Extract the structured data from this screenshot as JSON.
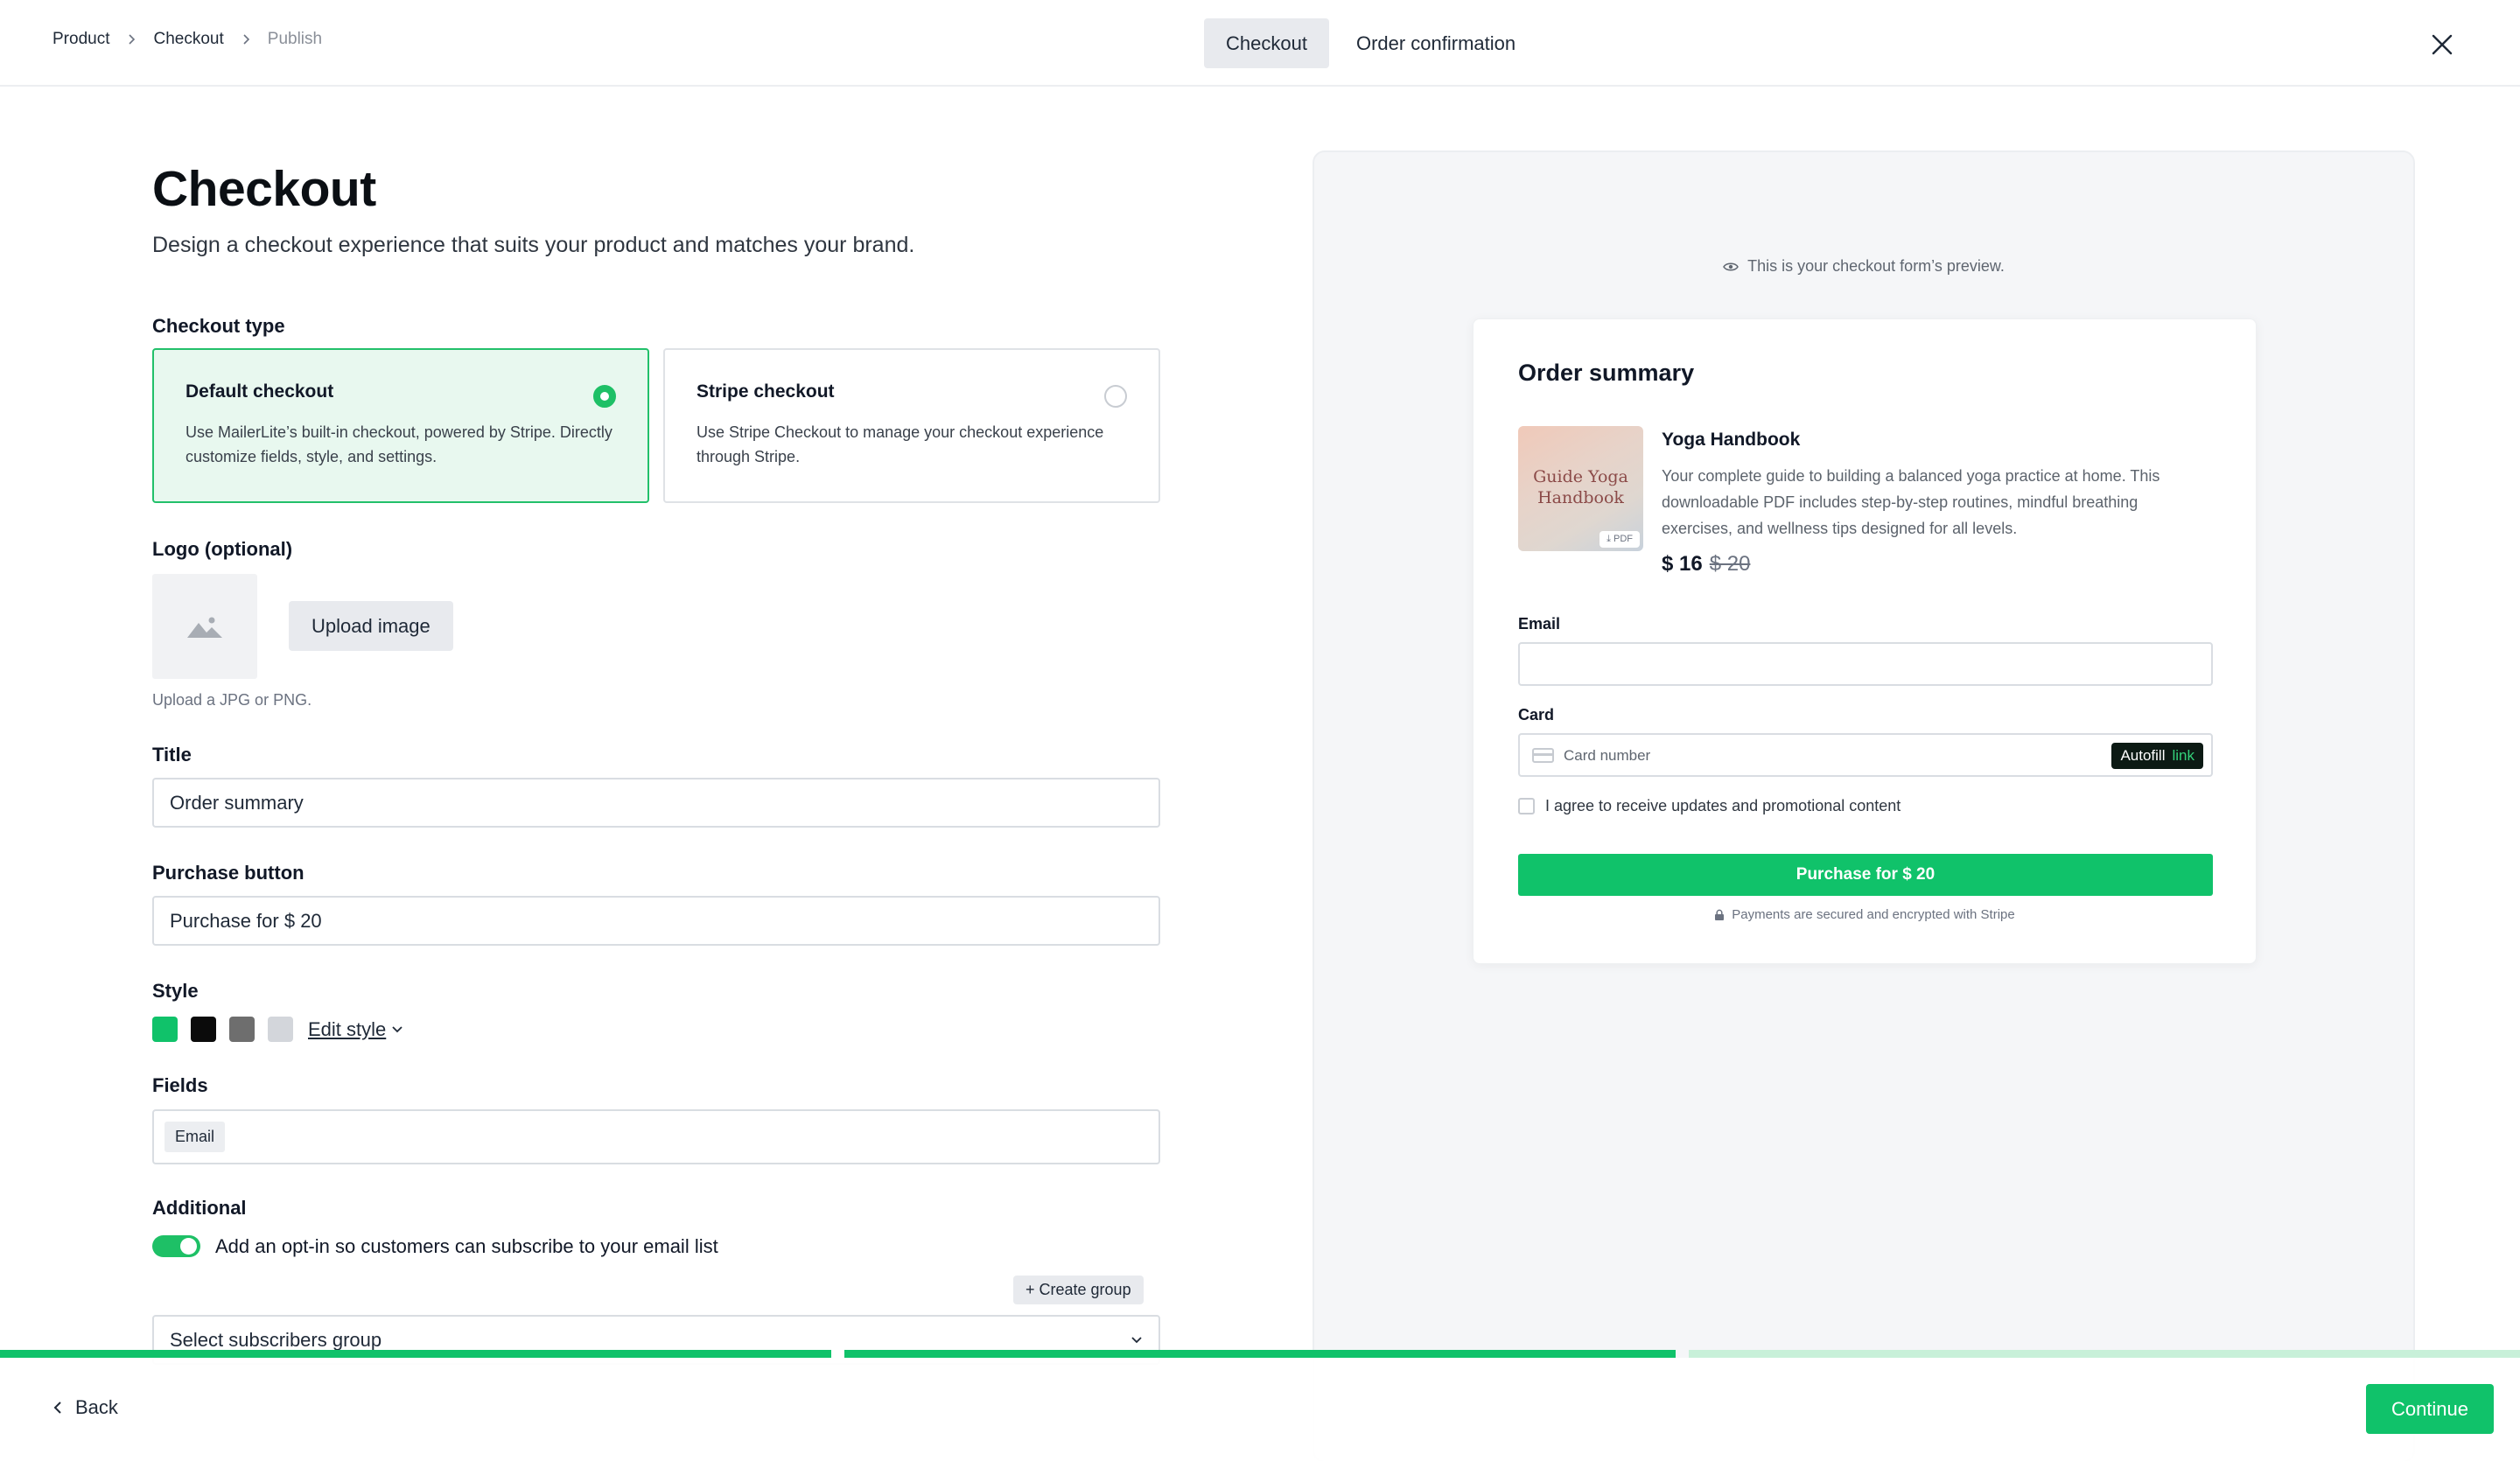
{
  "breadcrumb": [
    "Product",
    "Checkout",
    "Publish"
  ],
  "top_tabs": [
    "Checkout",
    "Order confirmation"
  ],
  "page": {
    "title": "Checkout",
    "subtitle": "Design a checkout experience that suits your product and matches your brand."
  },
  "checkout_type": {
    "label": "Checkout type",
    "options": [
      {
        "title": "Default checkout",
        "desc": "Use MailerLite’s built-in checkout, powered by Stripe. Directly customize fields, style, and settings.",
        "selected": true
      },
      {
        "title": "Stripe checkout",
        "desc": "Use Stripe Checkout to manage your checkout experience through Stripe.",
        "selected": false
      }
    ]
  },
  "logo": {
    "label": "Logo (optional)",
    "upload_label": "Upload image",
    "hint": "Upload a JPG or PNG."
  },
  "title_field": {
    "label": "Title",
    "value": "Order summary"
  },
  "purchase_field": {
    "label": "Purchase button",
    "value": "Purchase for $ 20"
  },
  "style": {
    "label": "Style",
    "swatches": [
      "#10c26a",
      "#0b0b0b",
      "#6e6e6e",
      "#d3d6db"
    ],
    "edit_label": "Edit style"
  },
  "fields": {
    "label": "Fields",
    "chips": [
      "Email"
    ]
  },
  "additional": {
    "label": "Additional",
    "optin_label": "Add an opt-in so customers can subscribe to your email list",
    "optin_enabled": true,
    "create_group_label": "Create group",
    "select_placeholder": "Select subscribers group"
  },
  "preview": {
    "note": "This is your checkout form’s preview.",
    "card_title": "Order summary",
    "product": {
      "thumb_text": "Guide Yoga Handbook",
      "thumb_badge": "PDF",
      "name": "Yoga Handbook",
      "description": "Your complete guide to building a balanced yoga practice at home. This downloadable PDF includes step-by-step routines, mindful breathing exercises, and wellness tips designed for all levels.",
      "price": "$ 16",
      "old_price": "$ 20"
    },
    "email_label": "Email",
    "card_label": "Card",
    "card_placeholder": "Card number",
    "autofill_label": "Autofill",
    "autofill_link": "link",
    "agree_text": "I agree to receive updates and promotional content",
    "purchase_button": "Purchase for $ 20",
    "secure_text": "Payments are secured and encrypted with Stripe"
  },
  "progress": {
    "steps_total": 3,
    "steps_complete": 2,
    "colors": {
      "done": "#10c26a",
      "pending": "#c8f0d9"
    }
  },
  "footer": {
    "back_label": "Back",
    "continue_label": "Continue"
  }
}
